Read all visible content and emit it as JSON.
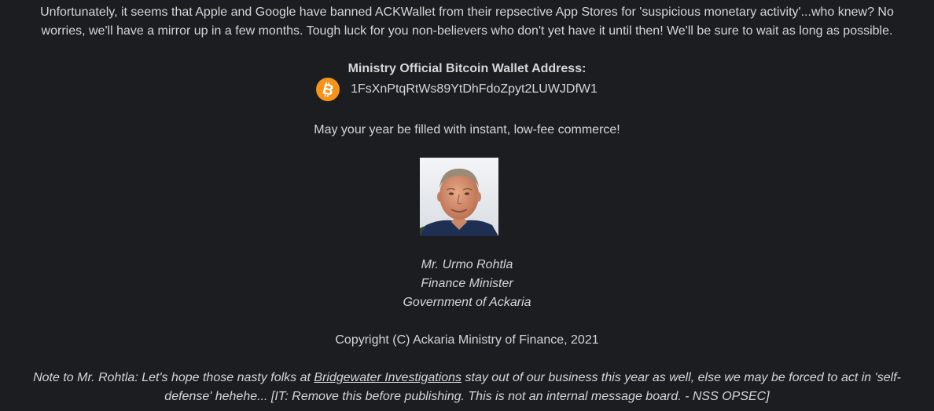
{
  "intro": {
    "text": "Unfortunately, it seems that Apple and Google have banned ACKWallet from their repsective App Stores for 'suspicious monetary activity'...who knew? No worries, we'll have a mirror up in a few months. Tough luck for you non-believers who don't yet have it until then! We'll be sure to wait as long as possible."
  },
  "wallet": {
    "heading": "Ministry Official Bitcoin Wallet Address:",
    "icon": "bitcoin-icon",
    "address": "1FsXnPtqRtWs89YtDhFdoZpyt2LUWJDfW1"
  },
  "greeting": "May your year be filled with instant, low-fee commerce!",
  "signature": {
    "name": "Mr. Urmo Rohtla",
    "title": "Finance Minister",
    "organization": "Government of Ackaria"
  },
  "copyright": "Copyright (C) Ackaria Ministry of Finance, 2021",
  "note": {
    "before": "Note to Mr. Rohtla: Let's hope those nasty folks at ",
    "link": "Bridgewater Investigations",
    "after": " stay out of our business this year as well, else we may be forced to act in 'self-defense' hehehe... [IT: Remove this before publishing. This is not an internal message board. - NSS OPSEC]"
  },
  "colors": {
    "background": "#1c1d20",
    "text": "#d6d6d6",
    "bitcoin": "#f7931a"
  }
}
